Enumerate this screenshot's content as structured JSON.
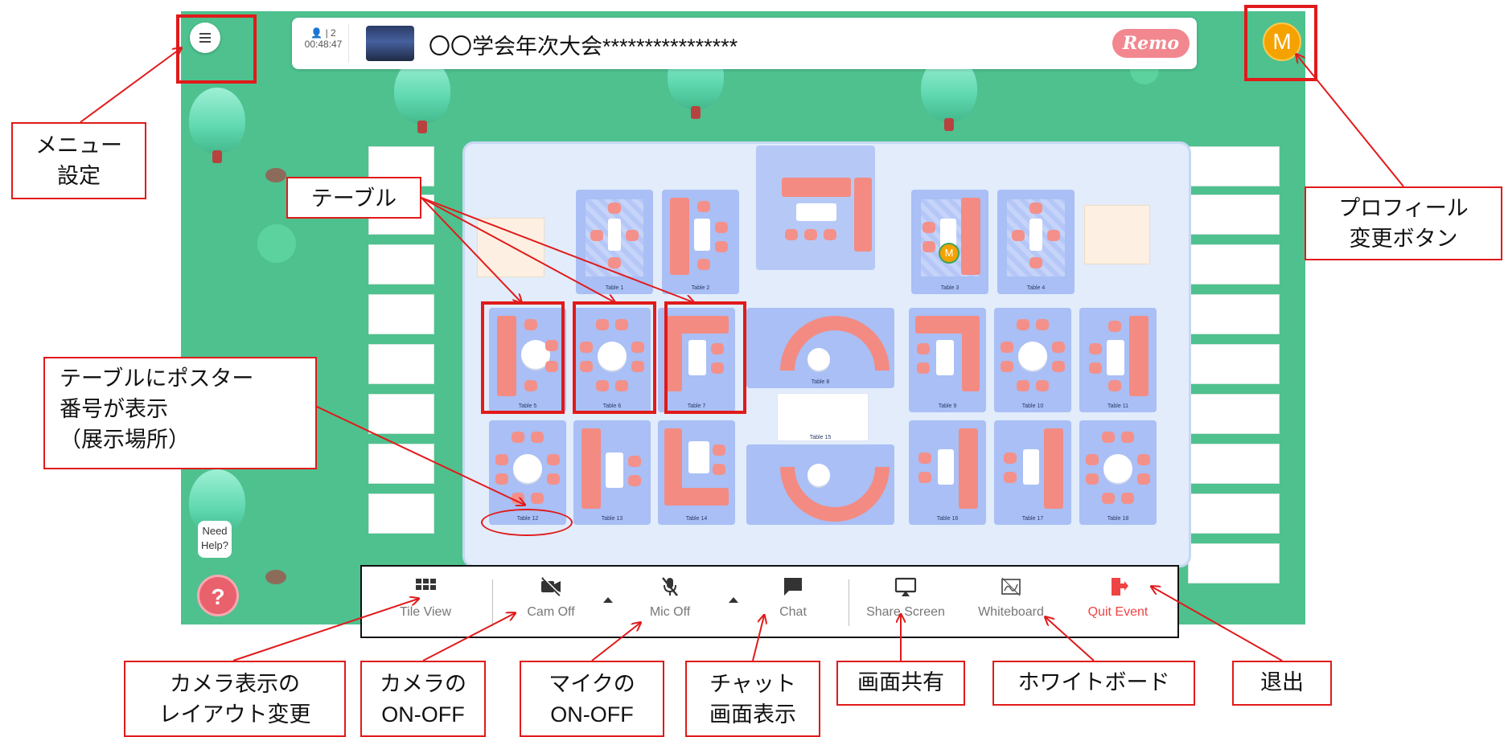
{
  "header": {
    "participant_count": "2",
    "elapsed_time": "00:48:47",
    "event_title": "〇〇学会年次大会****************",
    "logo_text": "Remo"
  },
  "profile": {
    "avatar_initial": "M"
  },
  "tables": {
    "t1": "Table 1",
    "t2": "Table 2",
    "t3": "Table 3",
    "t4": "Table 4",
    "t5": "Table 5",
    "t6": "Table 6",
    "t7": "Table 7",
    "t8": "Table 8",
    "t9": "Table 9",
    "t10": "Table 10",
    "t11": "Table 11",
    "t12": "Table 12",
    "t13": "Table 13",
    "t14": "Table 14",
    "t15": "Table 15",
    "t16": "Table 16",
    "t17": "Table 17",
    "t18": "Table 18"
  },
  "toolbar": {
    "tile_view": "Tile View",
    "cam_off": "Cam Off",
    "mic_off": "Mic Off",
    "chat": "Chat",
    "share_screen": "Share Screen",
    "whiteboard": "Whiteboard",
    "quit_event": "Quit Event"
  },
  "help": {
    "bubble_line1": "Need",
    "bubble_line2": "Help?",
    "button": "?"
  },
  "annotations": {
    "menu": [
      "メニュー",
      "設定"
    ],
    "profile": [
      "プロフィール",
      "変更ボタン"
    ],
    "table": [
      "テーブル"
    ],
    "poster": [
      "テーブルにポスター",
      "番号が表示",
      "（展示場所）"
    ],
    "camera_layout": [
      "カメラ表示の",
      "レイアウト変更"
    ],
    "camera_onoff": [
      "カメラの",
      "ON-OFF"
    ],
    "mic_onoff": [
      "マイクの",
      "ON-OFF"
    ],
    "chat_view": [
      "チャット",
      "画面表示"
    ],
    "screen_share": [
      "画面共有"
    ],
    "whiteboard": [
      "ホワイトボード"
    ],
    "exit": [
      "退出"
    ]
  },
  "colors": {
    "field_green": "#4ec18f",
    "annotation_red": "#e11a1a",
    "quit_red": "#ef4444",
    "sofa_pink": "#f38b83",
    "table_blue": "#a9bff5"
  }
}
